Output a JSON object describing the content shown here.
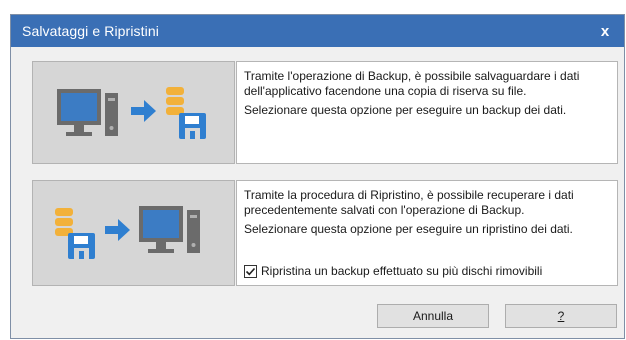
{
  "window": {
    "title": "Salvataggi e Ripristini",
    "close_glyph": "x"
  },
  "backup": {
    "description_1": "Tramite l'operazione di Backup, è possibile salvaguardare i dati dell'applicativo facendone una copia di riserva su file.",
    "description_2": "Selezionare questa opzione per eseguire un backup dei dati."
  },
  "restore": {
    "description_1": "Tramite la procedura di Ripristino, è possibile recuperare i dati precedentemente salvati con l'operazione di Backup.",
    "description_2": "Selezionare questa opzione per eseguire un ripristino dei dati.",
    "checkbox_label": "Ripristina un backup effettuato su più dischi rimovibili",
    "checkbox_checked": true
  },
  "buttons": {
    "cancel_label": "Annulla",
    "help_label": "?"
  },
  "colors": {
    "titlebar": "#3a6fb5",
    "monitor_screen": "#3c7cc4",
    "arrow": "#2f7fd0",
    "database": "#f2b13a",
    "floppy": "#2f7fd0",
    "pc_gray": "#6b6b6b"
  }
}
